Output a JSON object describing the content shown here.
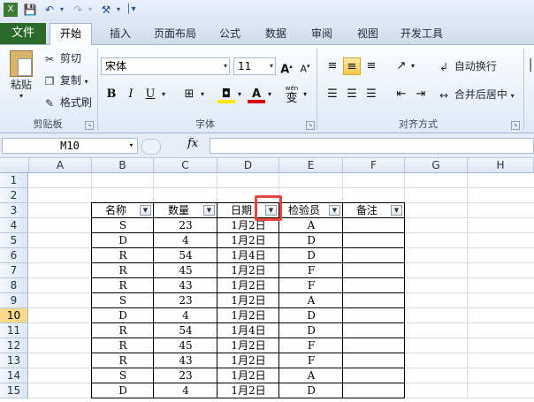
{
  "qat": {
    "save_icon": "save-icon",
    "undo_icon": "undo-icon",
    "redo_icon": "redo-icon",
    "format_painter_icon": "brush-icon"
  },
  "tabs": {
    "file": "文件",
    "home": "开始",
    "items": [
      "插入",
      "页面布局",
      "公式",
      "数据",
      "审阅",
      "视图",
      "开发工具"
    ]
  },
  "ribbon": {
    "clipboard": {
      "paste": "粘贴",
      "cut": "剪切",
      "copy": "复制",
      "format_painter": "格式刷",
      "group": "剪贴板"
    },
    "font": {
      "family": "宋体",
      "size": "11",
      "bold": "B",
      "italic": "I",
      "underline": "U",
      "group": "字体",
      "wen": "wén"
    },
    "alignment": {
      "wrap": "自动换行",
      "merge": "合并后居中",
      "group": "对齐方式"
    }
  },
  "formula_bar": {
    "name_box": "M10",
    "fx": "fx",
    "content": ""
  },
  "grid": {
    "columns": [
      "A",
      "B",
      "C",
      "D",
      "E",
      "F",
      "G",
      "H"
    ],
    "rows": [
      "1",
      "2",
      "3",
      "4",
      "5",
      "6",
      "7",
      "8",
      "9",
      "10",
      "11",
      "12",
      "13",
      "14",
      "15"
    ],
    "selected_row": "10",
    "headers": [
      "名称",
      "数量",
      "日期",
      "检验员",
      "备注"
    ],
    "data": [
      [
        "S",
        "23",
        "1月2日",
        "A",
        ""
      ],
      [
        "D",
        "4",
        "1月2日",
        "D",
        ""
      ],
      [
        "R",
        "54",
        "1月4日",
        "D",
        ""
      ],
      [
        "R",
        "45",
        "1月2日",
        "F",
        ""
      ],
      [
        "R",
        "43",
        "1月2日",
        "F",
        ""
      ],
      [
        "S",
        "23",
        "1月2日",
        "A",
        ""
      ],
      [
        "D",
        "4",
        "1月2日",
        "D",
        ""
      ],
      [
        "R",
        "54",
        "1月4日",
        "D",
        ""
      ],
      [
        "R",
        "45",
        "1月2日",
        "F",
        ""
      ],
      [
        "R",
        "43",
        "1月2日",
        "F",
        ""
      ],
      [
        "S",
        "23",
        "1月2日",
        "A",
        ""
      ],
      [
        "D",
        "4",
        "1月2日",
        "D",
        ""
      ]
    ]
  },
  "colors": {
    "file_tab": "#2a6a2a",
    "highlight": "#e8453c",
    "selected_row": "#f9d98a"
  }
}
